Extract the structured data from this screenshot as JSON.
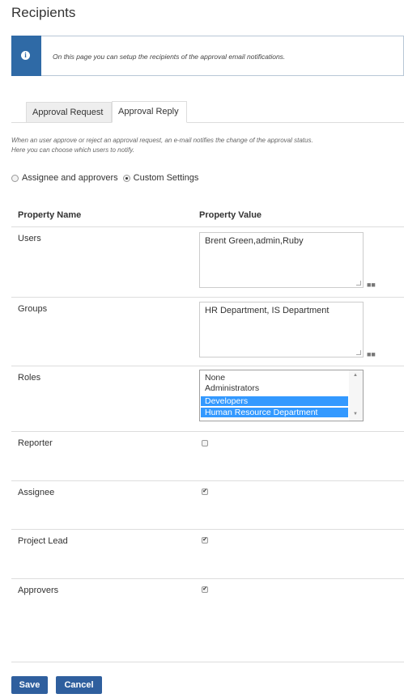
{
  "page": {
    "title": "Recipients"
  },
  "info": {
    "icon": "info-icon",
    "text": "On this page you can setup the recipients of the approval email notifications."
  },
  "tabs": [
    {
      "label": "Approval Request",
      "active": false
    },
    {
      "label": "Approval Reply",
      "active": true
    }
  ],
  "description": {
    "line1": "When an user approve or reject an approval request, an e-mail notifies the change of the approval status.",
    "line2": "Here you can choose which users to notify."
  },
  "mode": {
    "options": [
      {
        "label": "Assignee and approvers",
        "checked": false
      },
      {
        "label": "Custom Settings",
        "checked": true
      }
    ]
  },
  "table": {
    "headers": {
      "name": "Property Name",
      "value": "Property Value"
    },
    "users": {
      "label": "Users",
      "value": "Brent Green,admin,Ruby"
    },
    "groups": {
      "label": "Groups",
      "value": "HR Department, IS Department"
    },
    "roles": {
      "label": "Roles",
      "options": [
        {
          "label": "None",
          "selected": false
        },
        {
          "label": "Administrators",
          "selected": false
        },
        {
          "label": "Developers",
          "selected": true
        },
        {
          "label": "Human Resource Department",
          "selected": true
        }
      ]
    },
    "reporter": {
      "label": "Reporter",
      "checked": false
    },
    "assignee": {
      "label": "Assignee",
      "checked": true
    },
    "project_lead": {
      "label": "Project Lead",
      "checked": true
    },
    "approvers": {
      "label": "Approvers",
      "checked": true
    }
  },
  "actions": {
    "save": "Save",
    "cancel": "Cancel"
  },
  "colors": {
    "accent": "#2f6aa6",
    "button": "#2f5f9e",
    "selection": "#3399ff"
  }
}
